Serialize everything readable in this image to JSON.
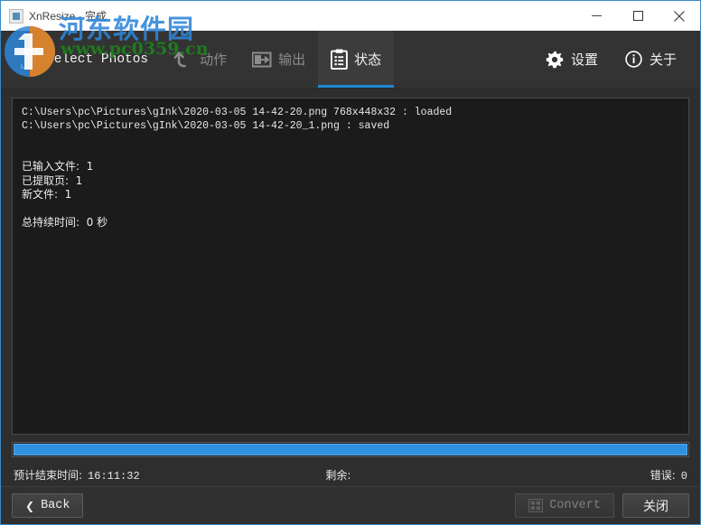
{
  "window": {
    "title": "XnResize - 完成",
    "app_icon": "app-icon",
    "controls": {
      "minimize": "minimize-icon",
      "maximize": "maximize-icon",
      "close": "close-icon"
    }
  },
  "watermark": {
    "site_name": "河东软件园",
    "url": "www.pc0359.cn",
    "brand_blue": "#2f86d8",
    "brand_green": "#1f7a1f"
  },
  "toolbar": {
    "tabs": [
      {
        "label": "Select Photos",
        "icon": "checkbox-checked-icon",
        "state": "normal"
      },
      {
        "label": "动作",
        "icon": "undo-arrow-icon",
        "state": "dim"
      },
      {
        "label": "输出",
        "icon": "export-icon",
        "state": "dim"
      },
      {
        "label": "状态",
        "icon": "clipboard-icon",
        "state": "active"
      }
    ],
    "right_items": [
      {
        "label": "设置",
        "icon": "gear-icon"
      },
      {
        "label": "关于",
        "icon": "info-icon"
      }
    ],
    "active_accent": "#1f8ad2"
  },
  "log": {
    "lines": [
      "C:\\Users\\pc\\Pictures\\gInk\\2020-03-05 14-42-20.png 768x448x32 : loaded",
      "C:\\Users\\pc\\Pictures\\gInk\\2020-03-05 14-42-20_1.png : saved"
    ],
    "stats": [
      "已输入文件:  1",
      "已提取页:  1",
      "新文件:  1"
    ],
    "duration": "总持续时间:  0 秒"
  },
  "progress": {
    "percent": 100,
    "fill_color": "#2f90e0"
  },
  "status": {
    "eta_label": "预计结束时间:",
    "eta_value": "16:11:32",
    "remaining_label": "剩余:",
    "remaining_value": "",
    "errors_label": "错误:",
    "errors_value": "0"
  },
  "footer": {
    "back_label": "Back",
    "back_chevron": "❮",
    "convert_label": "Convert",
    "convert_icon": "film-strip-icon",
    "convert_enabled": false,
    "close_label": "关闭"
  }
}
